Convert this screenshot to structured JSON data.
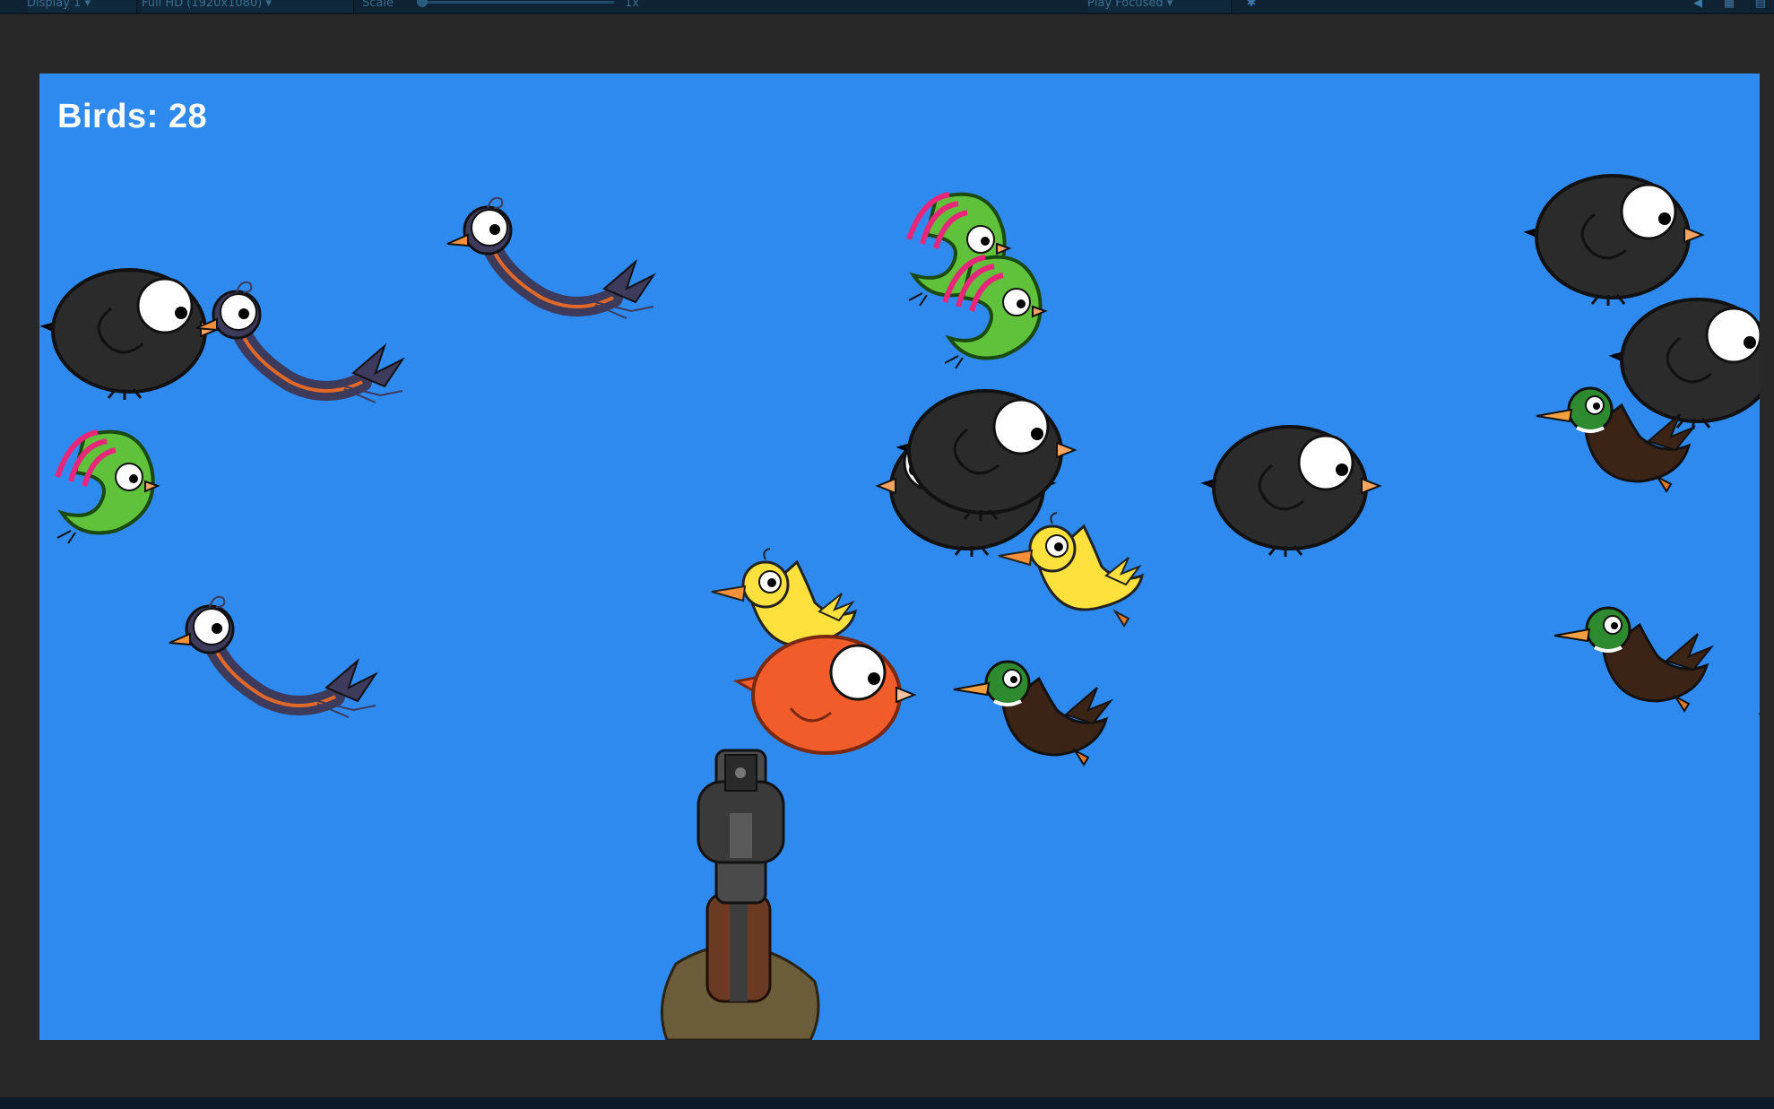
{
  "toolbar": {
    "display_label": "Display 1",
    "resolution_label": "Full HD (1920x1080)",
    "scale_label": "Scale",
    "scale_value": "1x",
    "play_mode_label": "Play Focused",
    "icons": [
      "bug-icon",
      "mute-audio-icon",
      "stats-icon",
      "gizmos-icon"
    ]
  },
  "game": {
    "score_label": "Birds: 28",
    "background_color": "#2f8aef",
    "bird_types": [
      "black-round-bird",
      "purple-long-neck-bird",
      "green-parrot",
      "yellow-duck",
      "mallard-duck",
      "orange-round-bird"
    ],
    "weapon": "revolver"
  }
}
